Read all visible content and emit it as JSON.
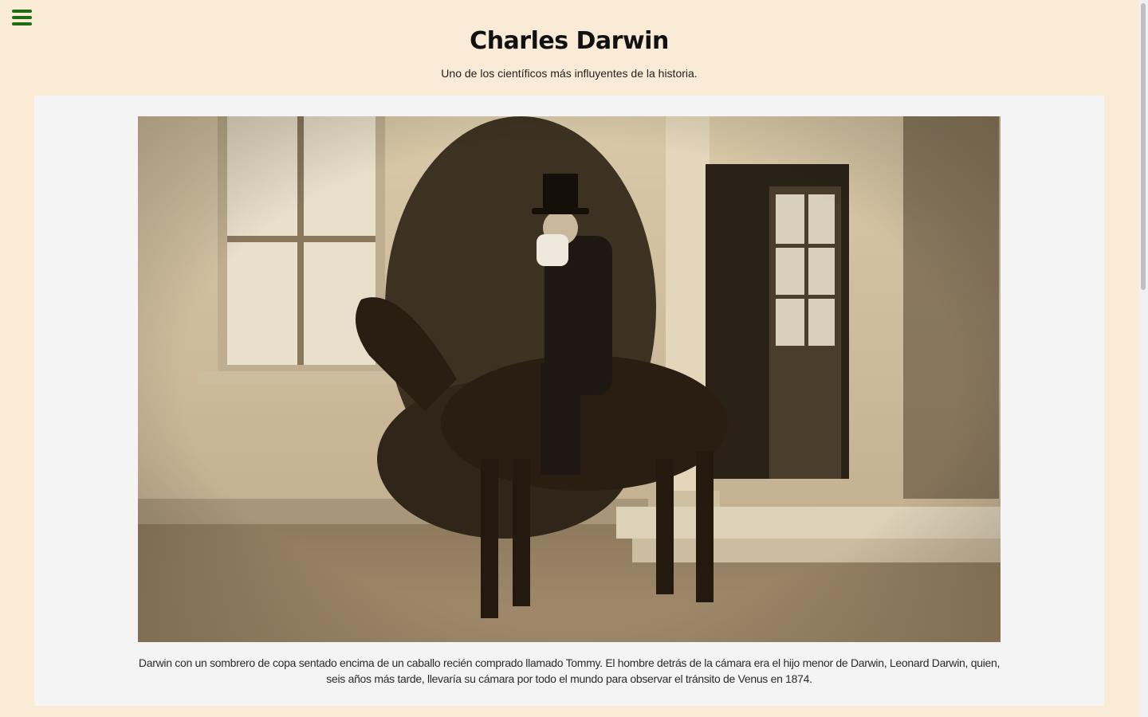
{
  "header": {
    "menu_icon": "hamburger-menu-icon",
    "title": "Charles Darwin",
    "subtitle": "Uno de los científicos más influyentes de la historia."
  },
  "figure": {
    "image_alt": "Darwin con un sombrero de copa sentado encima de un caballo",
    "caption": "Darwin con un sombrero de copa sentado encima de un caballo recién comprado llamado Tommy. El hombre detrás de la cámara era el hijo menor de Darwin, Leonard Darwin, quien, seis años más tarde, llevaría su cámara por todo el mundo para observar el tránsito de Venus en 1874."
  },
  "colors": {
    "page_background": "#faebd7",
    "card_background": "#f4f4f4",
    "menu_icon": "#1e6b12"
  }
}
